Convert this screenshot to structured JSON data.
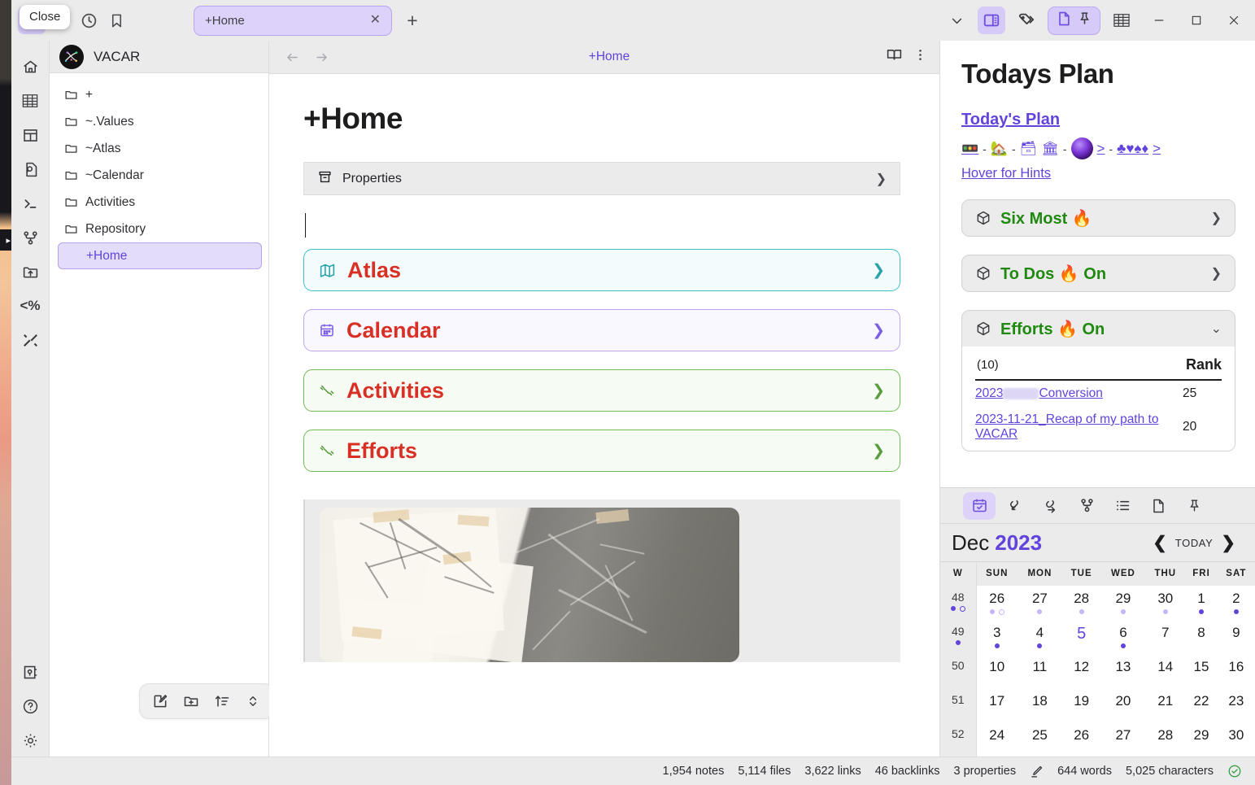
{
  "titlebar": {
    "tooltip": "Close",
    "tab": {
      "title": "+Home",
      "close_glyph": "✕"
    },
    "new_tab_glyph": "+",
    "icons": {
      "folder": "folder-icon",
      "search": "search-icon",
      "history": "clock-icon",
      "bookmark": "bookmark-icon",
      "chevron_down": "chevron-down-icon",
      "split_view": "split-view-icon",
      "tags": "tags-icon",
      "page": "page-icon",
      "pin": "pin-icon",
      "table": "table-icon"
    },
    "window_controls": {
      "minimize": "–",
      "maximize": "☐",
      "close": "✕"
    }
  },
  "rail": {
    "items": [
      {
        "name": "home-icon"
      },
      {
        "name": "table-icon"
      },
      {
        "name": "layout-icon"
      },
      {
        "name": "file-search-icon"
      },
      {
        "name": "terminal-icon"
      },
      {
        "name": "git-graph-icon"
      },
      {
        "name": "folder-upload-icon"
      },
      {
        "name": "template-icon",
        "label": "<%"
      },
      {
        "name": "tools-icon"
      }
    ],
    "bottom": [
      {
        "name": "vault-icon"
      },
      {
        "name": "help-icon"
      },
      {
        "name": "settings-icon"
      }
    ]
  },
  "explorer": {
    "vault_name": "VACAR",
    "files": [
      {
        "label": "+",
        "type": "folder"
      },
      {
        "label": "~.Values",
        "type": "folder"
      },
      {
        "label": "~Atlas",
        "type": "folder"
      },
      {
        "label": "~Calendar",
        "type": "folder"
      },
      {
        "label": "Activities",
        "type": "folder"
      },
      {
        "label": "Repository",
        "type": "folder"
      },
      {
        "label": "+Home",
        "type": "file",
        "selected": true
      }
    ],
    "toolbar": [
      {
        "name": "new-note-icon"
      },
      {
        "name": "new-folder-icon"
      },
      {
        "name": "sort-icon"
      },
      {
        "name": "collapse-icon"
      }
    ]
  },
  "main": {
    "view_title": "+Home",
    "note_title": "+Home",
    "properties_label": "Properties",
    "properties_chevron": "❯",
    "callouts": [
      {
        "label": "Atlas",
        "icon": "map-icon",
        "style": "atlas",
        "chevron": "❯"
      },
      {
        "label": "Calendar",
        "icon": "calendar-icon",
        "style": "calendar",
        "chevron": "❯"
      },
      {
        "label": "Activities",
        "icon": "dumbbell-icon",
        "style": "green",
        "chevron": "❯"
      },
      {
        "label": "Efforts",
        "icon": "dumbbell-icon",
        "style": "green",
        "chevron": "❯"
      }
    ],
    "header_icons": {
      "reading": "book-open-icon",
      "more": "more-vertical-icon"
    }
  },
  "right_panel": {
    "heading": "Todays Plan",
    "plan_link": "Today's Plan",
    "breadcrumb_emojis": [
      "🚥",
      "🏡",
      "🗃",
      "🏛",
      "orb",
      "♣♥♠♦"
    ],
    "breadcrumb_separator": "-",
    "breadcrumb_caret": ">",
    "hints_link": "Hover for Hints",
    "boxes": [
      {
        "label": "Six Most 🔥",
        "chevron": "❯",
        "expanded": false
      },
      {
        "label": "To Dos 🔥 On",
        "chevron": "❯",
        "expanded": false
      },
      {
        "label": "Efforts 🔥 On",
        "chevron": "⌄",
        "expanded": true
      }
    ],
    "efforts_table": {
      "col1_header": "(10)",
      "col2_header": "Rank",
      "rows": [
        {
          "link_prefix": "2023",
          "link_suffix": "Conversion",
          "redacted": true,
          "rank": "25"
        },
        {
          "link_prefix": "2023-11-21_Recap of my path to VACAR",
          "link_suffix": "",
          "redacted": false,
          "rank": "20"
        }
      ]
    }
  },
  "calendar": {
    "toolbar": [
      {
        "name": "calendar-icon",
        "active": true
      },
      {
        "name": "backlink-icon",
        "active": false
      },
      {
        "name": "outgoing-link-icon",
        "active": false
      },
      {
        "name": "graph-icon",
        "active": false
      },
      {
        "name": "outline-icon",
        "active": false
      },
      {
        "name": "page-icon",
        "active": false
      },
      {
        "name": "pin-icon",
        "active": false
      }
    ],
    "month": "Dec",
    "year": "2023",
    "prev_glyph": "❮",
    "today_label": "TODAY",
    "next_glyph": "❯",
    "headers": [
      "W",
      "SUN",
      "MON",
      "TUE",
      "WED",
      "THU",
      "FRI",
      "SAT"
    ],
    "weeks": [
      {
        "week": "48",
        "week_dots": [
          "solid",
          "ring"
        ],
        "days": [
          {
            "n": "26",
            "other": true,
            "dots": [
              "faint",
              "ring-faint"
            ]
          },
          {
            "n": "27",
            "other": true,
            "dots": [
              "faint"
            ]
          },
          {
            "n": "28",
            "other": true,
            "dots": [
              "faint"
            ]
          },
          {
            "n": "29",
            "other": true,
            "dots": [
              "faint"
            ]
          },
          {
            "n": "30",
            "other": true,
            "dots": [
              "faint"
            ]
          },
          {
            "n": "1",
            "other": false,
            "dots": [
              "solid"
            ]
          },
          {
            "n": "2",
            "other": false,
            "dots": [
              "solid"
            ]
          }
        ]
      },
      {
        "week": "49",
        "week_dots": [
          "solid"
        ],
        "days": [
          {
            "n": "3",
            "other": false,
            "dots": [
              "solid"
            ]
          },
          {
            "n": "4",
            "other": false,
            "dots": [
              "solid"
            ]
          },
          {
            "n": "5",
            "other": false,
            "today": true,
            "dots": []
          },
          {
            "n": "6",
            "other": false,
            "dots": [
              "solid"
            ]
          },
          {
            "n": "7",
            "other": false,
            "dots": []
          },
          {
            "n": "8",
            "other": false,
            "dots": []
          },
          {
            "n": "9",
            "other": false,
            "dots": []
          }
        ]
      },
      {
        "week": "50",
        "week_dots": [],
        "days": [
          {
            "n": "10",
            "other": false,
            "dots": []
          },
          {
            "n": "11",
            "other": false,
            "dots": []
          },
          {
            "n": "12",
            "other": false,
            "dots": []
          },
          {
            "n": "13",
            "other": false,
            "dots": []
          },
          {
            "n": "14",
            "other": false,
            "dots": []
          },
          {
            "n": "15",
            "other": false,
            "dots": []
          },
          {
            "n": "16",
            "other": false,
            "dots": []
          }
        ]
      },
      {
        "week": "51",
        "week_dots": [],
        "days": [
          {
            "n": "17",
            "other": false,
            "dots": []
          },
          {
            "n": "18",
            "other": false,
            "dots": []
          },
          {
            "n": "19",
            "other": false,
            "dots": []
          },
          {
            "n": "20",
            "other": false,
            "dots": []
          },
          {
            "n": "21",
            "other": false,
            "dots": []
          },
          {
            "n": "22",
            "other": false,
            "dots": []
          },
          {
            "n": "23",
            "other": false,
            "dots": []
          }
        ]
      },
      {
        "week": "52",
        "week_dots": [],
        "days": [
          {
            "n": "24",
            "other": false,
            "dots": []
          },
          {
            "n": "25",
            "other": false,
            "dots": []
          },
          {
            "n": "26",
            "other": false,
            "dots": []
          },
          {
            "n": "27",
            "other": false,
            "dots": []
          },
          {
            "n": "28",
            "other": false,
            "dots": []
          },
          {
            "n": "29",
            "other": false,
            "dots": []
          },
          {
            "n": "30",
            "other": false,
            "dots": []
          }
        ]
      }
    ]
  },
  "statusbar": {
    "items": [
      "1,954 notes",
      "5,114 files",
      "3,622 links",
      "46 backlinks",
      "3 properties"
    ],
    "pencil_icon": "pencil-icon",
    "words": "644 words",
    "characters": "5,025 characters",
    "check_icon": "check-circle-icon"
  },
  "colors": {
    "accent": "#6243dc",
    "accent_soft": "#ddd3fa",
    "callout_red": "#d93025",
    "callout_green": "#1f8a0f",
    "teal": "#3fc0c9",
    "status_ok": "#2e9c3c"
  }
}
